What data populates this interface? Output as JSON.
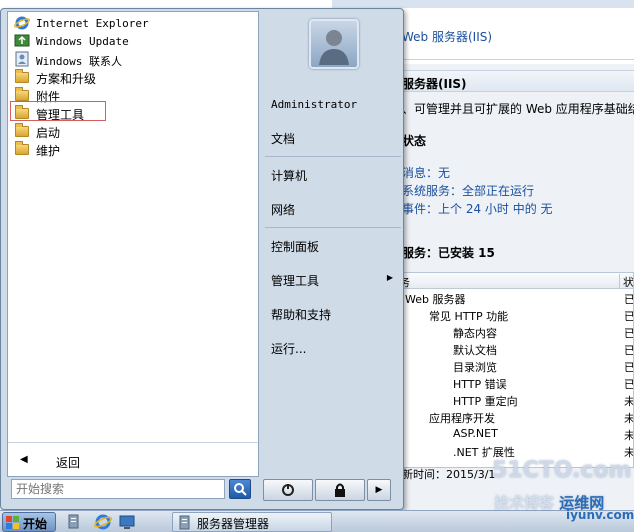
{
  "programs": [
    {
      "label": "Internet Explorer",
      "icon": "internet-explorer-icon",
      "mono": true
    },
    {
      "label": "Windows Update",
      "icon": "windows-update-icon",
      "mono": true
    },
    {
      "label": "Windows 联系人",
      "icon": "contacts-icon",
      "mono": true
    },
    {
      "label": "方案和升级",
      "icon": "folder-icon",
      "mono": false
    },
    {
      "label": "附件",
      "icon": "folder-icon",
      "mono": false
    },
    {
      "label": "管理工具",
      "icon": "folder-icon",
      "mono": false
    },
    {
      "label": "启动",
      "icon": "folder-icon",
      "mono": false
    },
    {
      "label": "维护",
      "icon": "folder-icon",
      "mono": false
    }
  ],
  "left": {
    "back_label": "返回",
    "search_placeholder": "开始搜索"
  },
  "right": {
    "user_name": "Administrator",
    "documents": "文档",
    "computer": "计算机",
    "network": "网络",
    "control_panel": "控制面板",
    "admin_tools": "管理工具",
    "help": "帮助和支持",
    "run": "运行..."
  },
  "taskbar": {
    "start_label": "开始",
    "task_label": "服务器管理器"
  },
  "background": {
    "role_link": "Web 服务器(IIS)",
    "section_title": "服务器(IIS)",
    "description": "、可管理并且可扩展的 Web 应用程序基础结",
    "status_title": "状态",
    "stat_messages": "消息：无",
    "stat_services": "系统服务：全部正在运行",
    "stat_events": "事件：上个 24 小时 中的 无",
    "roles_title": "服务：已安装 15",
    "table_header_name": "务",
    "table_header_status": "状",
    "rows": [
      {
        "name": "Web 服务器",
        "status": "已",
        "indent": 0
      },
      {
        "name": "常见 HTTP 功能",
        "status": "已",
        "indent": 1
      },
      {
        "name": "静态内容",
        "status": "已",
        "indent": 2
      },
      {
        "name": "默认文档",
        "status": "已",
        "indent": 2
      },
      {
        "name": "目录浏览",
        "status": "已",
        "indent": 2
      },
      {
        "name": "HTTP 错误",
        "status": "已",
        "indent": 2
      },
      {
        "name": "HTTP 重定向",
        "status": "未",
        "indent": 2
      },
      {
        "name": "应用程序开发",
        "status": "未",
        "indent": 1
      },
      {
        "name": "ASP.NET",
        "status": "未",
        "indent": 2
      },
      {
        "name": ".NET 扩展性",
        "status": "未",
        "indent": 2
      }
    ],
    "footer_text": "新时间：2015/3/1"
  },
  "watermark": {
    "line1": "51CTO.com",
    "line2": "技术博客",
    "line3": "运维网",
    "line4": "iyunv.com"
  }
}
